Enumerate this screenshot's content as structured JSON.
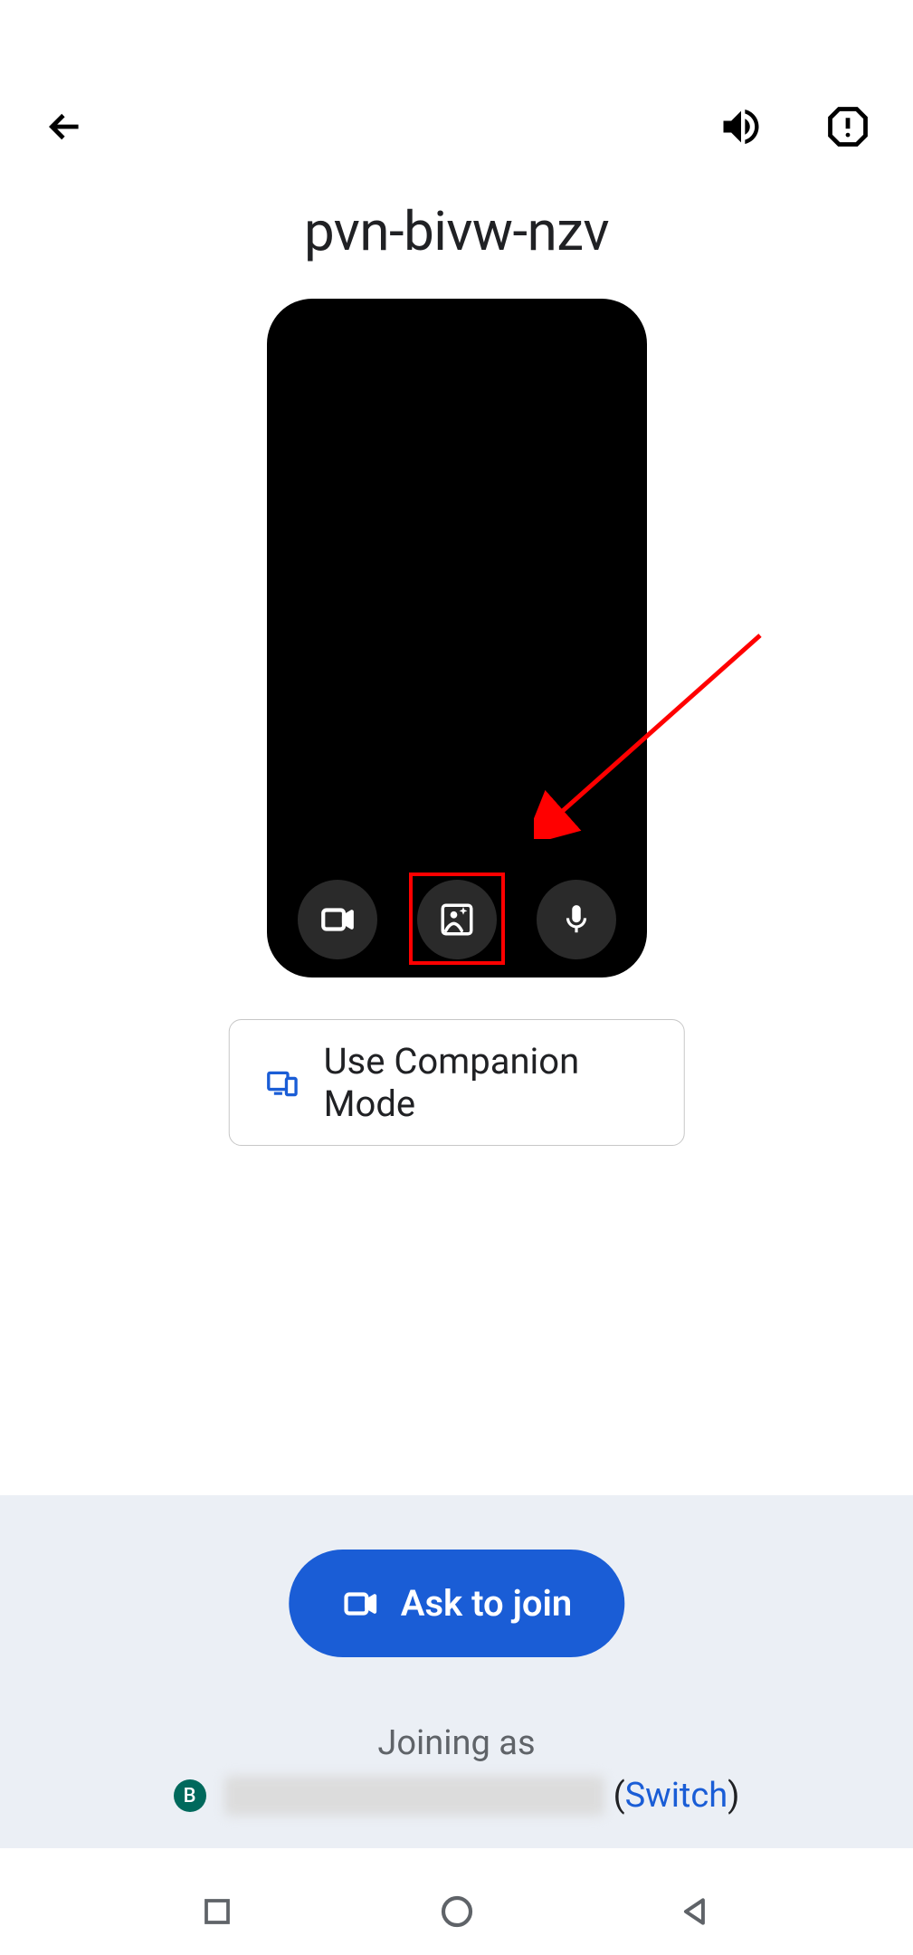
{
  "header": {
    "meeting_code": "pvn-bivw-nzv"
  },
  "companion": {
    "label": "Use Companion Mode"
  },
  "join": {
    "ask_label": "Ask to join",
    "joining_as_label": "Joining as",
    "avatar_initial": "B",
    "switch_prefix": "(",
    "switch_label": "Switch",
    "switch_suffix": ")"
  },
  "icons": {
    "back": "back-arrow-icon",
    "audio": "speaker-icon",
    "report": "report-icon",
    "camera": "camera-icon",
    "effects": "effects-icon",
    "mic": "mic-icon",
    "companion": "devices-icon",
    "join_cam": "camera-icon"
  }
}
